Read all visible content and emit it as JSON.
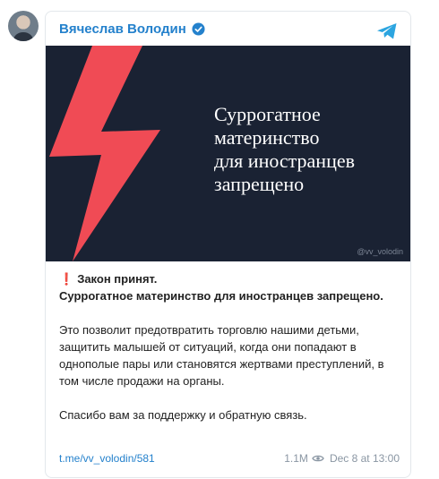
{
  "channel": {
    "name": "Вячеслав Володин"
  },
  "banner": {
    "lines": [
      "Суррогатное",
      "материнство",
      "для иностранцев",
      "запрещено"
    ],
    "watermark": "@vv_volodin",
    "bg_color": "#1a2233",
    "bolt_color": "#f04b55"
  },
  "post": {
    "mark": "❗",
    "line1": "Закон принят.",
    "line2": "Суррогатное материнство для иностранцев запрещено.",
    "para1": "Это позволит предотвратить торговлю нашими детьми, защитить малышей от ситуаций, когда они попадают в однополые пары или становятся жертвами преступлений, в том числе продажи на органы.",
    "para2": "Спасибо вам за поддержку и обратную связь."
  },
  "footer": {
    "link": "t.me/vv_volodin/581",
    "views": "1.1M",
    "date": "Dec 8 at 13:00"
  },
  "icons": {
    "avatar": "avatar-photo",
    "verified": "verified-check-icon",
    "telegram": "telegram-plane-icon",
    "views": "eye-icon"
  }
}
